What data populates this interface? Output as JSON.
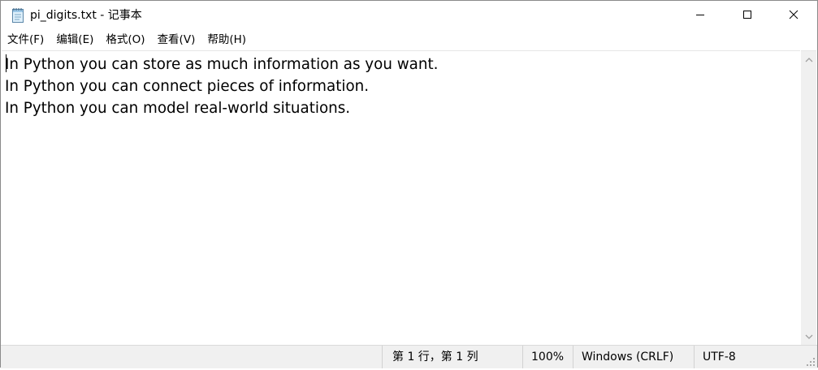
{
  "window": {
    "title": "pi_digits.txt - 记事本",
    "icon": "notepad-icon",
    "controls": {
      "minimize_icon": "minimize-icon",
      "maximize_icon": "maximize-icon",
      "close_icon": "close-icon"
    }
  },
  "menu": {
    "items": [
      {
        "label": "文件(F)"
      },
      {
        "label": "编辑(E)"
      },
      {
        "label": "格式(O)"
      },
      {
        "label": "查看(V)"
      },
      {
        "label": "帮助(H)"
      }
    ]
  },
  "editor": {
    "lines": [
      "In Python you can store as much information as you want.",
      "In Python you can connect pieces of information.",
      "In Python you can model real-world situations."
    ]
  },
  "statusbar": {
    "position": "第 1 行，第 1 列",
    "zoom": "100%",
    "line_ending": "Windows (CRLF)",
    "encoding": "UTF-8"
  },
  "colors": {
    "background": "#ffffff",
    "statusbar_bg": "#f0f0f0",
    "scrollbar_bg": "#f0f0f0"
  }
}
